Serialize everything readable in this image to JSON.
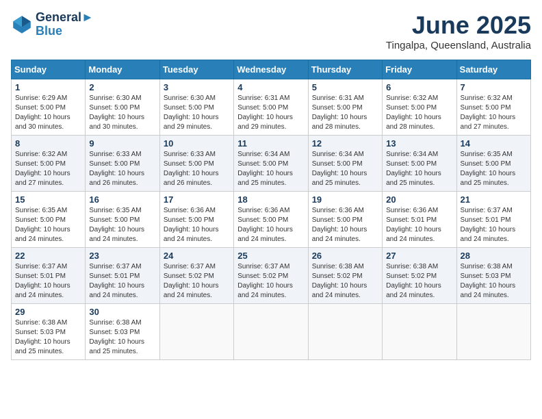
{
  "header": {
    "logo_line1": "General",
    "logo_line2": "Blue",
    "month_title": "June 2025",
    "location": "Tingalpa, Queensland, Australia"
  },
  "calendar": {
    "days_of_week": [
      "Sunday",
      "Monday",
      "Tuesday",
      "Wednesday",
      "Thursday",
      "Friday",
      "Saturday"
    ],
    "weeks": [
      [
        {
          "day": "1",
          "info": "Sunrise: 6:29 AM\nSunset: 5:00 PM\nDaylight: 10 hours\nand 30 minutes."
        },
        {
          "day": "2",
          "info": "Sunrise: 6:30 AM\nSunset: 5:00 PM\nDaylight: 10 hours\nand 30 minutes."
        },
        {
          "day": "3",
          "info": "Sunrise: 6:30 AM\nSunset: 5:00 PM\nDaylight: 10 hours\nand 29 minutes."
        },
        {
          "day": "4",
          "info": "Sunrise: 6:31 AM\nSunset: 5:00 PM\nDaylight: 10 hours\nand 29 minutes."
        },
        {
          "day": "5",
          "info": "Sunrise: 6:31 AM\nSunset: 5:00 PM\nDaylight: 10 hours\nand 28 minutes."
        },
        {
          "day": "6",
          "info": "Sunrise: 6:32 AM\nSunset: 5:00 PM\nDaylight: 10 hours\nand 28 minutes."
        },
        {
          "day": "7",
          "info": "Sunrise: 6:32 AM\nSunset: 5:00 PM\nDaylight: 10 hours\nand 27 minutes."
        }
      ],
      [
        {
          "day": "8",
          "info": "Sunrise: 6:32 AM\nSunset: 5:00 PM\nDaylight: 10 hours\nand 27 minutes."
        },
        {
          "day": "9",
          "info": "Sunrise: 6:33 AM\nSunset: 5:00 PM\nDaylight: 10 hours\nand 26 minutes."
        },
        {
          "day": "10",
          "info": "Sunrise: 6:33 AM\nSunset: 5:00 PM\nDaylight: 10 hours\nand 26 minutes."
        },
        {
          "day": "11",
          "info": "Sunrise: 6:34 AM\nSunset: 5:00 PM\nDaylight: 10 hours\nand 25 minutes."
        },
        {
          "day": "12",
          "info": "Sunrise: 6:34 AM\nSunset: 5:00 PM\nDaylight: 10 hours\nand 25 minutes."
        },
        {
          "day": "13",
          "info": "Sunrise: 6:34 AM\nSunset: 5:00 PM\nDaylight: 10 hours\nand 25 minutes."
        },
        {
          "day": "14",
          "info": "Sunrise: 6:35 AM\nSunset: 5:00 PM\nDaylight: 10 hours\nand 25 minutes."
        }
      ],
      [
        {
          "day": "15",
          "info": "Sunrise: 6:35 AM\nSunset: 5:00 PM\nDaylight: 10 hours\nand 24 minutes."
        },
        {
          "day": "16",
          "info": "Sunrise: 6:35 AM\nSunset: 5:00 PM\nDaylight: 10 hours\nand 24 minutes."
        },
        {
          "day": "17",
          "info": "Sunrise: 6:36 AM\nSunset: 5:00 PM\nDaylight: 10 hours\nand 24 minutes."
        },
        {
          "day": "18",
          "info": "Sunrise: 6:36 AM\nSunset: 5:00 PM\nDaylight: 10 hours\nand 24 minutes."
        },
        {
          "day": "19",
          "info": "Sunrise: 6:36 AM\nSunset: 5:00 PM\nDaylight: 10 hours\nand 24 minutes."
        },
        {
          "day": "20",
          "info": "Sunrise: 6:36 AM\nSunset: 5:01 PM\nDaylight: 10 hours\nand 24 minutes."
        },
        {
          "day": "21",
          "info": "Sunrise: 6:37 AM\nSunset: 5:01 PM\nDaylight: 10 hours\nand 24 minutes."
        }
      ],
      [
        {
          "day": "22",
          "info": "Sunrise: 6:37 AM\nSunset: 5:01 PM\nDaylight: 10 hours\nand 24 minutes."
        },
        {
          "day": "23",
          "info": "Sunrise: 6:37 AM\nSunset: 5:01 PM\nDaylight: 10 hours\nand 24 minutes."
        },
        {
          "day": "24",
          "info": "Sunrise: 6:37 AM\nSunset: 5:02 PM\nDaylight: 10 hours\nand 24 minutes."
        },
        {
          "day": "25",
          "info": "Sunrise: 6:37 AM\nSunset: 5:02 PM\nDaylight: 10 hours\nand 24 minutes."
        },
        {
          "day": "26",
          "info": "Sunrise: 6:38 AM\nSunset: 5:02 PM\nDaylight: 10 hours\nand 24 minutes."
        },
        {
          "day": "27",
          "info": "Sunrise: 6:38 AM\nSunset: 5:02 PM\nDaylight: 10 hours\nand 24 minutes."
        },
        {
          "day": "28",
          "info": "Sunrise: 6:38 AM\nSunset: 5:03 PM\nDaylight: 10 hours\nand 24 minutes."
        }
      ],
      [
        {
          "day": "29",
          "info": "Sunrise: 6:38 AM\nSunset: 5:03 PM\nDaylight: 10 hours\nand 25 minutes."
        },
        {
          "day": "30",
          "info": "Sunrise: 6:38 AM\nSunset: 5:03 PM\nDaylight: 10 hours\nand 25 minutes."
        },
        {
          "day": "",
          "info": ""
        },
        {
          "day": "",
          "info": ""
        },
        {
          "day": "",
          "info": ""
        },
        {
          "day": "",
          "info": ""
        },
        {
          "day": "",
          "info": ""
        }
      ]
    ]
  }
}
